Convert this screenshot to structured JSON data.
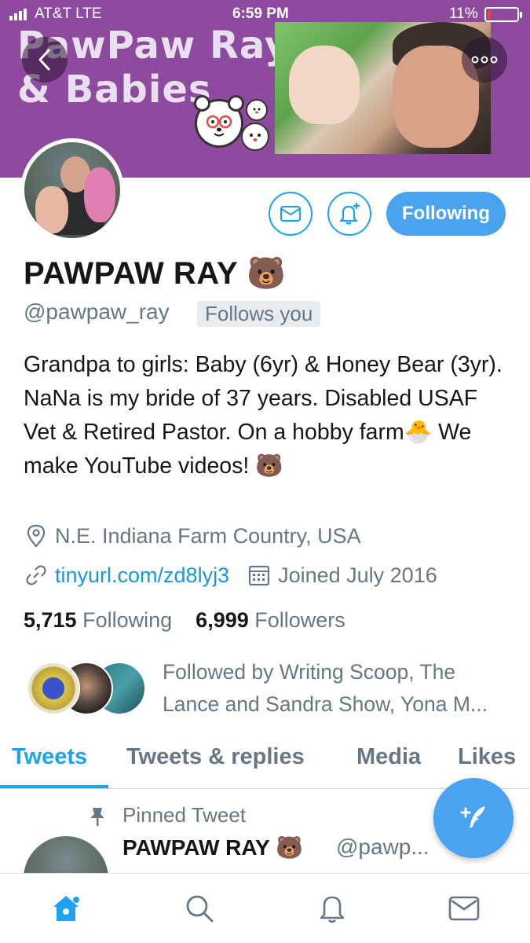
{
  "status_bar": {
    "carrier": "AT&T  LTE",
    "time": "6:59 PM",
    "battery_percent": "11%",
    "battery_level": 0.11
  },
  "header": {
    "banner_title_line1": "PawPaw Ray",
    "banner_title_line2": "& Babies",
    "back_icon": "chevron-left-icon",
    "more_icon": "more-horizontal-icon"
  },
  "actions": {
    "message_icon": "envelope-icon",
    "notify_icon": "bell-plus-icon",
    "following_label": "Following"
  },
  "profile": {
    "name": "PAWPAW RAY 🐻",
    "handle": "@pawpaw_ray",
    "follows_you": "Follows you",
    "bio": "Grandpa to girls: Baby (6yr) & Honey Bear (3yr). NaNa is my bride of 37 years. Disabled USAF Vet & Retired Pastor. On a hobby farm🐣 We make YouTube videos! 🐻",
    "location": "N.E. Indiana Farm Country, USA",
    "link": "tinyurl.com/zd8lyj3",
    "joined": "Joined July 2016",
    "following_count": "5,715",
    "following_label": "Following",
    "followers_count": "6,999",
    "followers_label": "Followers",
    "followed_by": "Followed by Writing Scoop, The Lance and Sandra Show, Yona M..."
  },
  "tabs": [
    {
      "label": "Tweets",
      "active": true
    },
    {
      "label": "Tweets & replies",
      "active": false
    },
    {
      "label": "Media",
      "active": false
    },
    {
      "label": "Likes",
      "active": false
    }
  ],
  "pinned_tweet": {
    "label": "Pinned Tweet",
    "name": "PAWPAW RAY 🐻",
    "handle": "@pawp..."
  },
  "compose": {
    "icon": "compose-tweet-icon"
  },
  "bottom_nav": [
    {
      "icon": "home-icon",
      "active": true
    },
    {
      "icon": "search-icon",
      "active": false
    },
    {
      "icon": "notifications-bell-icon",
      "active": false
    },
    {
      "icon": "messages-envelope-icon",
      "active": false
    }
  ],
  "colors": {
    "accent": "#1da1f2",
    "banner": "#8e4a9e",
    "muted": "#657786"
  }
}
